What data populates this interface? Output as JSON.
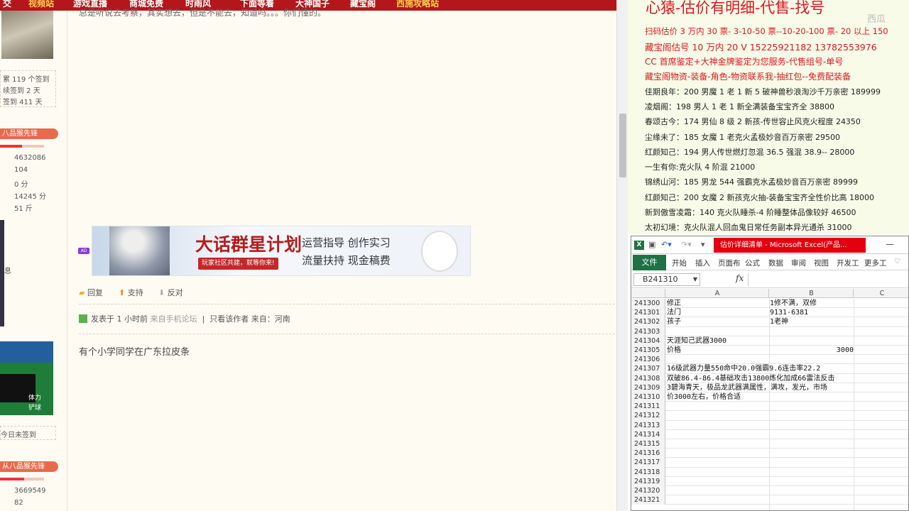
{
  "forum": {
    "nav_items": [
      "交",
      "视频站",
      "游戏直播",
      "商城免费",
      "时雨风",
      "下面等着",
      "大神国子",
      "藏宝阁",
      "西施攻略站"
    ],
    "cut_text": "总是听说去考察，其实想去，但是不能去，知道吗。。。你们懂的。",
    "sidebar": {
      "sign_lines": [
        "累 119 个签到",
        "续签到 2 天",
        "签到 411 天"
      ],
      "badge1": "八品猴先锋",
      "stats1": [
        "4632086",
        "104",
        "0 分",
        "14245 分",
        "51 斤"
      ],
      "side_note": "息",
      "ranking_text": [
        "体力",
        "铲球"
      ],
      "today_sign": "今日未签到",
      "badge2": "从八品猴先锋",
      "stats2": [
        "3669549",
        "82"
      ]
    },
    "banner": {
      "title": "大话群星计划",
      "slogan": "玩家社区共建，就等你来!",
      "right_line1": "运营指导   创作实习",
      "right_line2": "流量扶持   现金稿费",
      "ad_badge": "AD"
    },
    "actions": {
      "reply": "回复",
      "support": "支持",
      "oppose": "反对"
    },
    "post_meta": {
      "prefix": "发表于 1 小时前",
      "source": "来自手机论坛",
      "author_only": "只看该作者",
      "from": "来自：河南"
    },
    "post_body": "有个小学同学在广东拉皮条"
  },
  "overlay": {
    "headline": "心猿-估价有明细-代售-找号",
    "watermark": "西瓜",
    "red_lines": [
      "扫码估价 3 万内 30 票- 3-10-50 票--10-20-100 票- 20 以上 150",
      "藏宝阁估号 10 万内 20 V 15225921182    13782553976",
      "CC 首席鉴定+大神金牌鉴定为您服务-代售组号-单号",
      "藏宝阁物资-装备-角色-物资联系我-抽红包--免费配装备"
    ],
    "black_lines": [
      "佳期良年：200 男魔 1 老 1 新 5 破神兽秒浪淘沙千万亲密 189999",
      "凌烟阁：198 男人 1 老 1 新全满装备宝宝齐全 38800",
      "春颂古今：174 男仙 8 级 2 新孩-传世容止风克火程度 24350",
      "尘缘未了：185 女魔 1 老克火孟极妙音百万亲密 29500",
      "红颜知己：194 男人传世燃灯忽混 36.5 强混 38.9-- 28000",
      "一生有你:克火队 4 阶混 21000",
      "锦绣山河：185 男龙 544 强霸克水孟极妙音百万亲密 89999",
      "红颜知己：200 女魔 2 新孩克火抽-装备宝宝齐全性价比高 18000",
      "新到傲雪凌霜：140 克火队睡杀-4 阶睡整体品像较好 46500",
      "太初幻境：克火队混人回血鬼日常任务副本异光通杀 31000"
    ]
  },
  "excel": {
    "title": "估价详细清单 - Microsoft Excel(产品...",
    "tabs": [
      "文件",
      "开始",
      "插入",
      "页面布",
      "公式",
      "数据",
      "审阅",
      "视图",
      "开发工",
      "更多工"
    ],
    "name_box": "B241310",
    "fx": "fx",
    "columns": [
      "A",
      "B",
      "C"
    ],
    "rows": [
      {
        "n": "241300",
        "a": "修正",
        "b": "1修不满，双修"
      },
      {
        "n": "241301",
        "a": "法门",
        "b": "9131-6381"
      },
      {
        "n": "241302",
        "a": "孩子",
        "b": "1老神"
      },
      {
        "n": "241303",
        "a": "",
        "b": ""
      },
      {
        "n": "241304",
        "a": "天涯知己武器3000",
        "b": ""
      },
      {
        "n": "241305",
        "a": "价格",
        "b": "3000"
      },
      {
        "n": "241306",
        "a": "",
        "b": ""
      },
      {
        "n": "241307",
        "a": "16级武器力量550命中20.0强霸9.6连击率22.2",
        "b": ""
      },
      {
        "n": "241308",
        "a": "双破86.4-86.4基础攻击13800炼化加成66雷法反击",
        "b": ""
      },
      {
        "n": "241309",
        "a": "3碧海青天，极品龙武器满属性，满攻，发光，市场",
        "b": ""
      },
      {
        "n": "241310",
        "a": "价3000左右，价格合适",
        "b": ""
      },
      {
        "n": "241311",
        "a": "",
        "b": ""
      },
      {
        "n": "241312",
        "a": "",
        "b": ""
      },
      {
        "n": "241313",
        "a": "",
        "b": ""
      },
      {
        "n": "241314",
        "a": "",
        "b": ""
      },
      {
        "n": "241315",
        "a": "",
        "b": ""
      },
      {
        "n": "241316",
        "a": "",
        "b": ""
      },
      {
        "n": "241317",
        "a": "",
        "b": ""
      },
      {
        "n": "241318",
        "a": "",
        "b": ""
      },
      {
        "n": "241319",
        "a": "",
        "b": ""
      },
      {
        "n": "241320",
        "a": "",
        "b": ""
      },
      {
        "n": "241321",
        "a": "",
        "b": ""
      }
    ]
  },
  "colors": {
    "nav_red": "#b3171b",
    "overlay_red": "#e0161e",
    "excel_green": "#1f7244",
    "excel_title_red": "#e3000f"
  }
}
